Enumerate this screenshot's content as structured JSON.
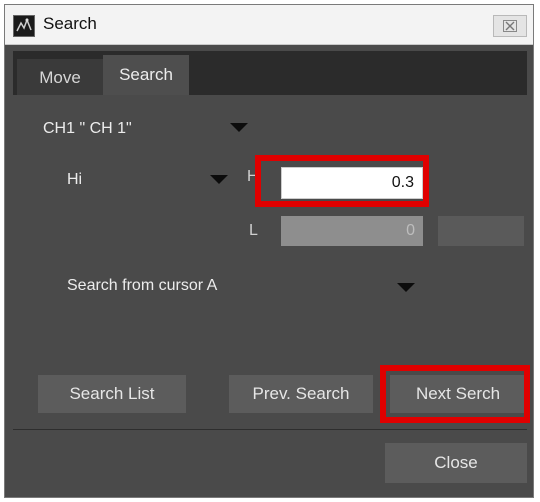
{
  "window": {
    "title": "Search",
    "close_label": "☒"
  },
  "tabs": [
    {
      "label": "Move",
      "active": false
    },
    {
      "label": "Search",
      "active": true
    }
  ],
  "search": {
    "channel_select": "CH1  \" CH 1\"",
    "mode_select": "Hi",
    "h_label": "H",
    "h_value": "0.3",
    "l_label": "L",
    "l_value": "0",
    "start_select": "Search from cursor A"
  },
  "buttons": {
    "search_list": "Search List",
    "prev_search": "Prev. Search",
    "next_search": "Next Serch",
    "close": "Close"
  },
  "colors": {
    "highlight": "#e00000",
    "panel": "#4a4a4a"
  },
  "icons": {
    "app": "app-icon",
    "close": "close-icon",
    "dropdown": "chevron-down-icon"
  }
}
